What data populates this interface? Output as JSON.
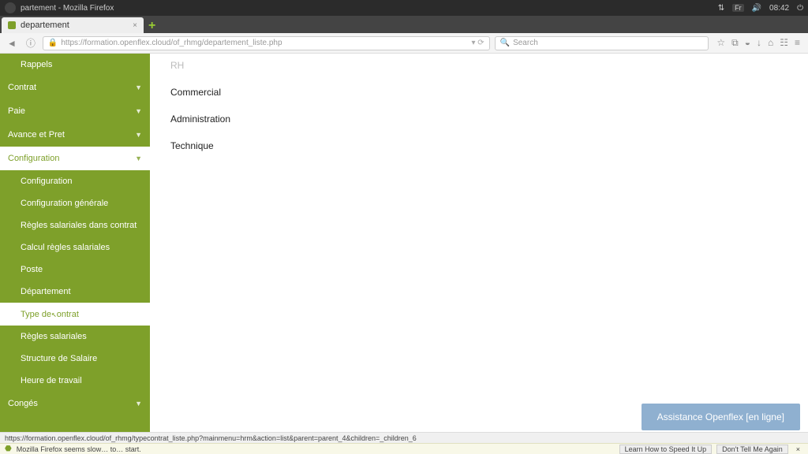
{
  "system_bar": {
    "title": "partement - Mozilla Firefox",
    "lang": "Fr",
    "time": "08:42"
  },
  "tab": {
    "title": "departement"
  },
  "url": "https://formation.openflex.cloud/of_rhmg/departement_liste.php",
  "search_placeholder": "Search",
  "sidebar": {
    "rappels": "Rappels",
    "sections": [
      {
        "key": "contrat",
        "label": "Contrat"
      },
      {
        "key": "paie",
        "label": "Paie"
      },
      {
        "key": "avance",
        "label": "Avance et Pret"
      }
    ],
    "config_label": "Configuration",
    "config_items": [
      "Configuration",
      "Configuration générale",
      "Règles salariales dans contrat",
      "Calcul règles salariales",
      "Poste",
      "Département",
      "Type de contrat",
      "Règles salariales",
      "Structure de Salaire",
      "Heure de travail"
    ],
    "config_selected_index": 6,
    "conges": "Congés"
  },
  "content_items": [
    "RH",
    "Commercial",
    "Administration",
    "Technique"
  ],
  "assist_label": "Assistance Openflex [en ligne]",
  "link_preview": "https://formation.openflex.cloud/of_rhmg/typecontrat_liste.php?mainmenu=hrm&action=list&parent=parent_4&children=_children_6",
  "notif": {
    "text": "Mozilla Firefox seems slow… to… start.",
    "btn1": "Learn How to Speed It Up",
    "btn2": "Don't Tell Me Again"
  }
}
